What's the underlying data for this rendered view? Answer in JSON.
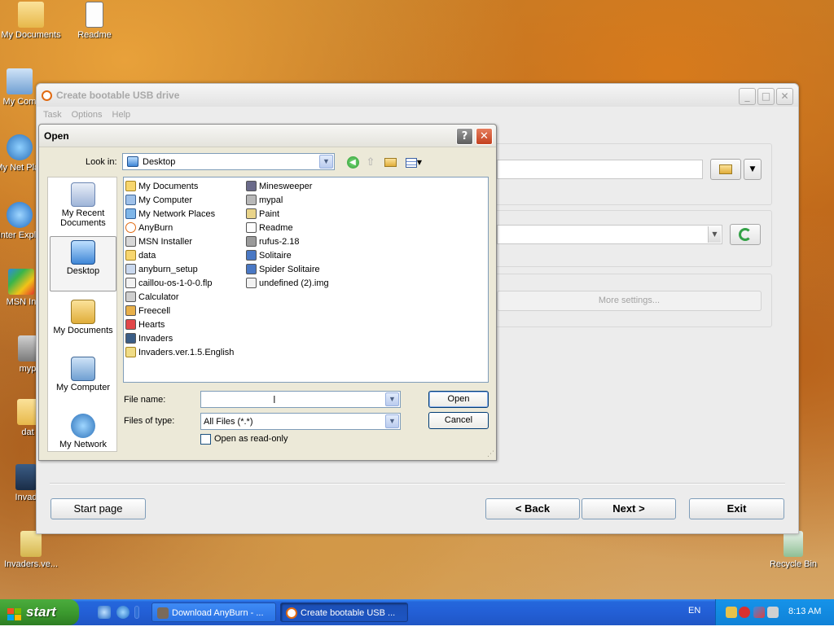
{
  "desktop": {
    "icons": [
      {
        "label": "My Documents"
      },
      {
        "label": "Readme"
      },
      {
        "label": "My Com"
      },
      {
        "label": "My Net Plac"
      },
      {
        "label": "Inter Explo"
      },
      {
        "label": "MSN In"
      },
      {
        "label": "myp"
      },
      {
        "label": "dat"
      },
      {
        "label": "Invad"
      },
      {
        "label": "Invaders.ve..."
      },
      {
        "label": "Recycle Bin"
      }
    ]
  },
  "main_window": {
    "title": "Create bootable USB drive",
    "menu": [
      "Task",
      "Options",
      "Help"
    ],
    "more_settings_label": "More settings...",
    "buttons": {
      "start_page": "Start page",
      "back": "< Back",
      "next": "Next >",
      "exit": "Exit"
    }
  },
  "open_dialog": {
    "title": "Open",
    "help_glyph": "?",
    "close_glyph": "✕",
    "look_in_label": "Look in:",
    "look_in_value": "Desktop",
    "places": [
      {
        "label": "My Recent Documents"
      },
      {
        "label": "Desktop"
      },
      {
        "label": "My Documents"
      },
      {
        "label": "My Computer"
      },
      {
        "label": "My Network"
      }
    ],
    "files_col1": [
      "My Documents",
      "My Computer",
      "My Network Places",
      "AnyBurn",
      "MSN Installer",
      "data",
      "anyburn_setup",
      "caillou-os-1-0-0.flp",
      "Calculator",
      "Freecell",
      "Hearts",
      "Invaders",
      "Invaders.ver.1.5.English"
    ],
    "files_col2": [
      "Minesweeper",
      "mypal",
      "Paint",
      "Readme",
      "rufus-2.18",
      "Solitaire",
      "Spider Solitaire",
      "undefined (2).img"
    ],
    "file_name_label": "File name:",
    "file_name_value": "",
    "file_type_label": "Files of type:",
    "file_type_value": "All Files (*.*)",
    "open_button": "Open",
    "cancel_button": "Cancel",
    "readonly_label": "Open as read-only"
  },
  "taskbar": {
    "start_label": "start",
    "tasks": [
      {
        "label": "Download AnyBurn - ..."
      },
      {
        "label": "Create bootable USB ..."
      }
    ],
    "language": "EN",
    "clock": "8:13 AM"
  },
  "colors": {
    "xp_blue": "#2467dc",
    "start_green": "#3c9a2f",
    "dialog_face": "#ece9d8",
    "close_red": "#c3401e"
  }
}
